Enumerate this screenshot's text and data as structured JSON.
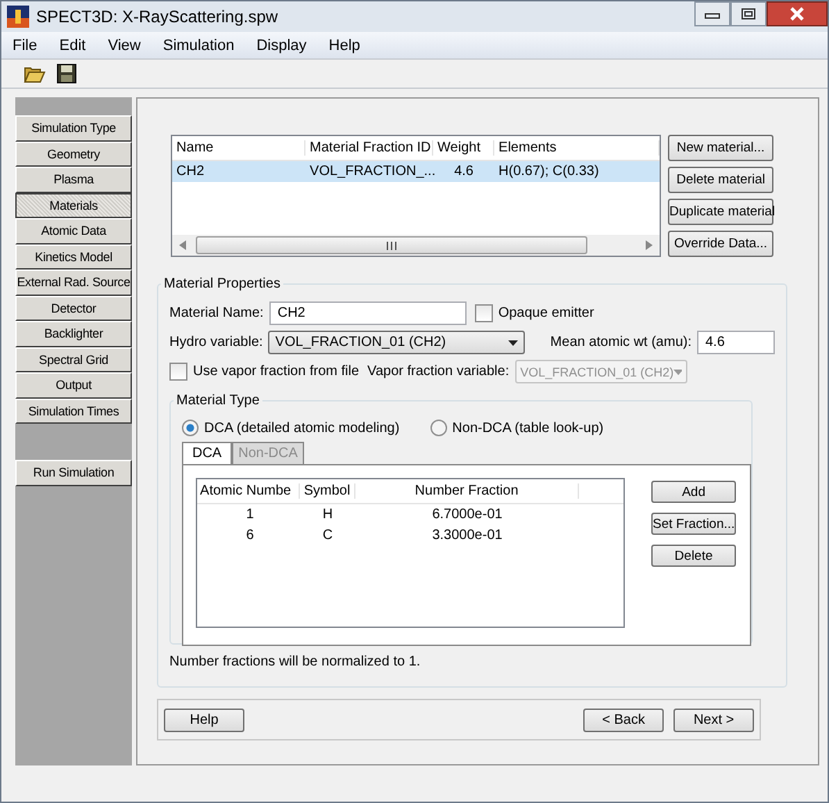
{
  "window": {
    "title": "SPECT3D:  X-RayScattering.spw"
  },
  "menu": [
    "File",
    "Edit",
    "View",
    "Simulation",
    "Display",
    "Help"
  ],
  "sidebar": {
    "items": [
      {
        "label": "Simulation Type",
        "selected": false
      },
      {
        "label": "Geometry",
        "selected": false
      },
      {
        "label": "Plasma",
        "selected": false
      },
      {
        "label": "Materials",
        "selected": true
      },
      {
        "label": "Atomic Data",
        "selected": false
      },
      {
        "label": "Kinetics Model",
        "selected": false
      },
      {
        "label": "External Rad. Source",
        "selected": false
      },
      {
        "label": "Detector",
        "selected": false
      },
      {
        "label": "Backlighter",
        "selected": false
      },
      {
        "label": "Spectral Grid",
        "selected": false
      },
      {
        "label": "Output",
        "selected": false
      },
      {
        "label": "Simulation Times",
        "selected": false
      }
    ],
    "run_button": "Run Simulation"
  },
  "materials_table": {
    "columns": [
      "Name",
      "Material Fraction ID",
      "Weight",
      "Elements"
    ],
    "rows": [
      {
        "cells": [
          "CH2",
          "VOL_FRACTION_...",
          "4.6",
          "H(0.67); C(0.33)"
        ],
        "selected": true
      }
    ]
  },
  "material_buttons": [
    "New material...",
    "Delete material",
    "Duplicate material",
    "Override Data..."
  ],
  "material_properties": {
    "title": "Material Properties",
    "name_label": "Material Name:",
    "name_value": "CH2",
    "opaque_emitter": {
      "label": "Opaque emitter",
      "checked": false
    },
    "hydro_label": "Hydro variable:",
    "hydro_value": "VOL_FRACTION_01 (CH2)",
    "mean_label": "Mean atomic wt (amu):",
    "mean_value": "4.6",
    "vapor_checkbox": {
      "label": "Use vapor fraction from file",
      "checked": false
    },
    "vapor_label": "Vapor fraction variable:",
    "vapor_value": "VOL_FRACTION_01 (CH2)",
    "vapor_disabled": true,
    "material_type": {
      "title": "Material Type",
      "options": [
        {
          "label": "DCA (detailed atomic modeling)",
          "selected": true
        },
        {
          "label": "Non-DCA (table look-up)",
          "selected": false
        }
      ],
      "tabs": [
        {
          "label": "DCA",
          "selected": true
        },
        {
          "label": "Non-DCA",
          "selected": false
        }
      ],
      "table": {
        "columns": [
          "Atomic Numbe",
          "Symbol",
          "Number Fraction"
        ],
        "rows": [
          [
            "1",
            "H",
            "6.7000e-01"
          ],
          [
            "6",
            "C",
            "3.3000e-01"
          ]
        ]
      },
      "buttons": [
        "Add",
        "Set Fraction...",
        "Delete"
      ]
    },
    "note": "Number fractions will be normalized to 1."
  },
  "footer": {
    "help": "Help",
    "back": "< Back",
    "next": "Next >"
  }
}
